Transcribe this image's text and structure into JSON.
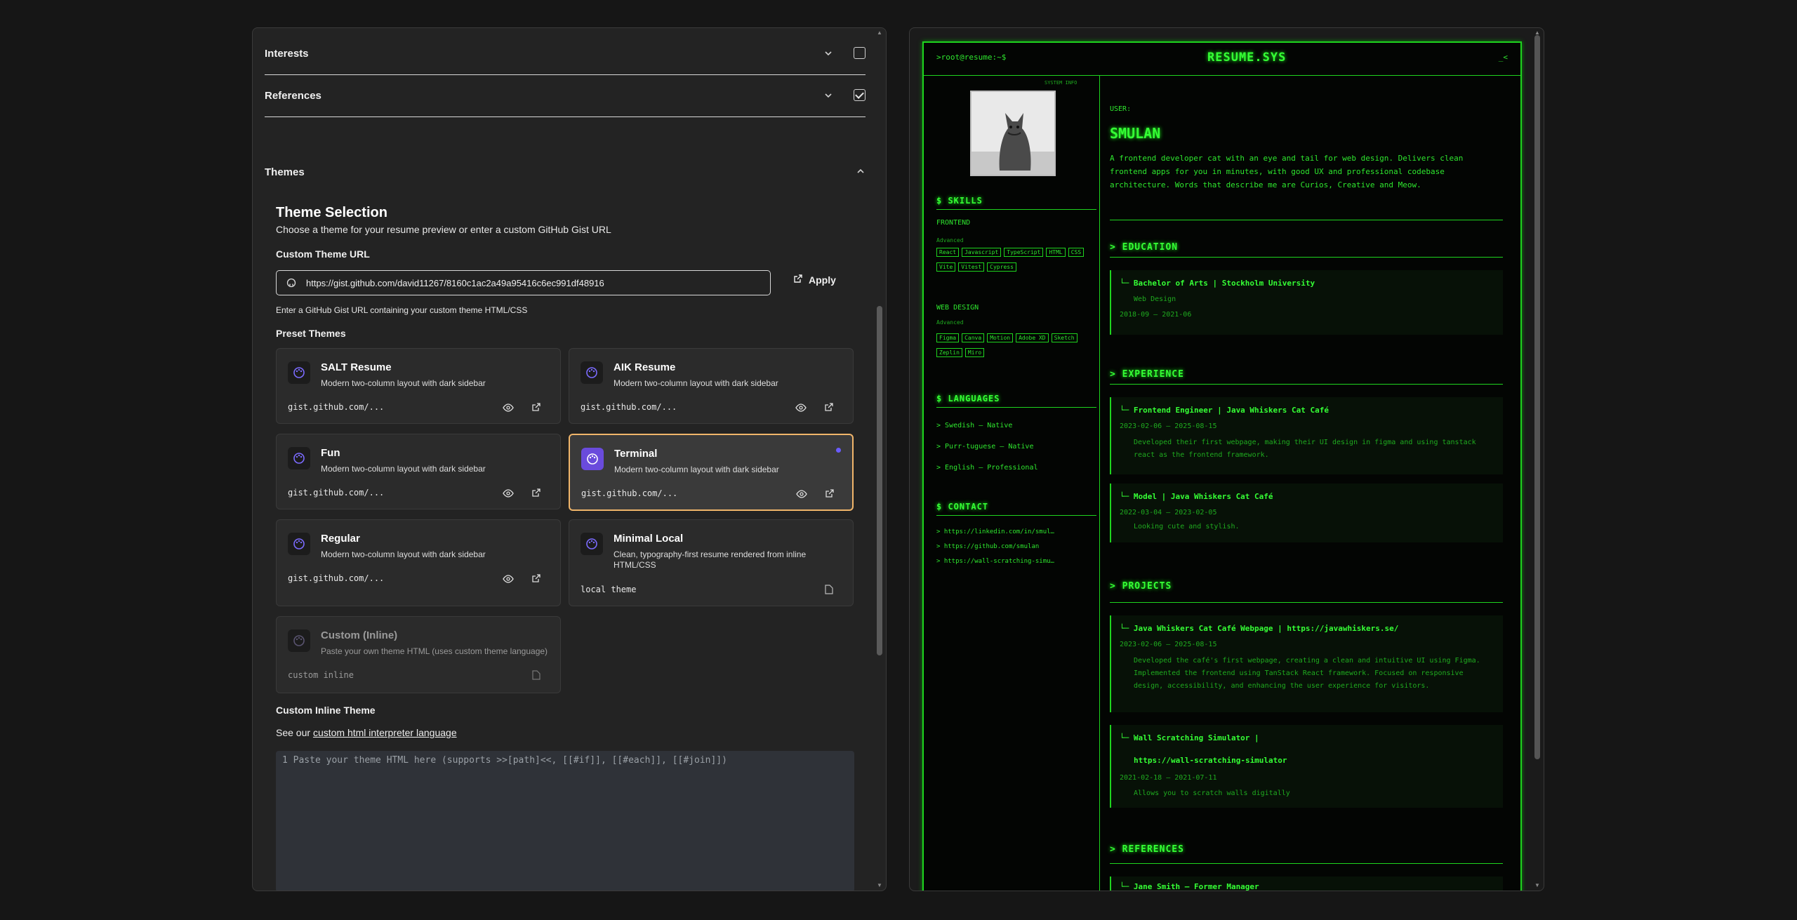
{
  "editor_panel": {
    "sections": [
      {
        "label": "Interests",
        "checked": false
      },
      {
        "label": "References",
        "checked": true
      }
    ],
    "themes_section": {
      "label": "Themes"
    },
    "theme_selection": {
      "title": "Theme Selection",
      "subtitle": "Choose a theme for your resume preview or enter a custom GitHub Gist URL",
      "custom_url_label": "Custom Theme URL",
      "custom_url_value": "https://gist.github.com/david11267/8160c1ac2a49a95416c6ec991df48916",
      "apply_label": "Apply",
      "url_hint": "Enter a GitHub Gist URL containing your custom theme HTML/CSS",
      "preset_label": "Preset Themes"
    },
    "themes": [
      {
        "name": "SALT Resume",
        "desc": "Modern two-column layout with dark sidebar",
        "source": "gist.github.com/..."
      },
      {
        "name": "AIK Resume",
        "desc": "Modern two-column layout with dark sidebar",
        "source": "gist.github.com/..."
      },
      {
        "name": "Fun",
        "desc": "Modern two-column layout with dark sidebar",
        "source": "gist.github.com/..."
      },
      {
        "name": "Terminal",
        "desc": "Modern two-column layout with dark sidebar",
        "source": "gist.github.com/...",
        "selected": true
      },
      {
        "name": "Regular",
        "desc": "Modern two-column layout with dark sidebar",
        "source": "gist.github.com/..."
      },
      {
        "name": "Minimal Local",
        "desc": "Clean, typography-first resume rendered from inline HTML/CSS",
        "source": "local theme"
      },
      {
        "name": "Custom (Inline)",
        "desc": "Paste your own theme HTML (uses custom theme language)",
        "source": "custom inline",
        "disabled": true
      }
    ],
    "custom_inline": {
      "title": "Custom Inline Theme",
      "see_prefix": "See our ",
      "link_text": "custom html interpreter language",
      "line_number": "1",
      "placeholder": "Paste your theme HTML here (supports >>[path]<<, [[#if]], [[#each]], [[#join]])"
    }
  },
  "preview": {
    "prompt": ">root@resume:~$",
    "title": "RESUME.SYS",
    "cursor": "_<",
    "system_info": "SYSTEM INFO",
    "user_label": "USER:",
    "name": "SMULAN",
    "summary": "A frontend developer cat with an eye and tail for web design. Delivers clean frontend apps for you in minutes, with good UX and professional codebase architecture. Words that describe me are Curios, Creative and Meow.",
    "skills_heading": "$ SKILLS",
    "skill_groups": [
      {
        "name": "FRONTEND",
        "level": "Advanced",
        "tags": [
          "React",
          "Javascript",
          "TypeScript",
          "HTML",
          "CSS",
          "Vite",
          "Vitest",
          "Cypress"
        ]
      },
      {
        "name": "WEB DESIGN",
        "level": "Advanced",
        "tags": [
          "Figma",
          "Canva",
          "Motion",
          "Adobe XD",
          "Sketch",
          "Zeplin",
          "Miro"
        ]
      }
    ],
    "languages_heading": "$ LANGUAGES",
    "languages": [
      "> Swedish — Native",
      "> Purr-tuguese — Native",
      "> English — Professional"
    ],
    "contact_heading": "$ CONTACT",
    "contacts": [
      "> https://linkedin.com/in/smul…",
      "> https://github.com/smulan",
      "> https://wall-scratching-simu…"
    ],
    "education_heading": "> EDUCATION",
    "education": [
      {
        "title": "└─ Bachelor of Arts  |  Stockholm University",
        "sub": "Web Design",
        "dates": "2018-09 — 2021-06"
      }
    ],
    "experience_heading": "> EXPERIENCE",
    "experience": [
      {
        "title": "└─ Frontend Engineer  |  Java Whiskers Cat Café",
        "dates": "2023-02-06 — 2025-08-15",
        "desc": "Developed their first webpage, making their UI design in figma and using tanstack react as the frontend framework."
      },
      {
        "title": "└─ Model  |  Java Whiskers Cat Café",
        "dates": "2022-03-04 — 2023-02-05",
        "desc": "Looking cute and stylish."
      }
    ],
    "projects_heading": "> PROJECTS",
    "projects": [
      {
        "title": "└─ Java Whiskers Cat Café Webpage  |  https://javawhiskers.se/",
        "dates": "2023-02-06 — 2025-08-15",
        "desc": "Developed the café's first webpage, creating a clean and intuitive UI using Figma. Implemented the frontend using TanStack React framework. Focused on responsive design, accessibility, and enhancing the user experience for visitors."
      },
      {
        "title": "└─ Wall Scratching Simulator  |",
        "title2": "https://wall-scratching-simulator",
        "dates": "2021-02-18 — 2021-07-11",
        "desc": "Allows you to scratch walls digitally"
      }
    ],
    "references_heading": "> REFERENCES",
    "references": [
      "└─ Jane Smith — Former Manager"
    ]
  },
  "colors": {
    "terminal_green": "#1ed41e",
    "selected_border": "#f0b56a",
    "accent": "#6a4bdc"
  }
}
